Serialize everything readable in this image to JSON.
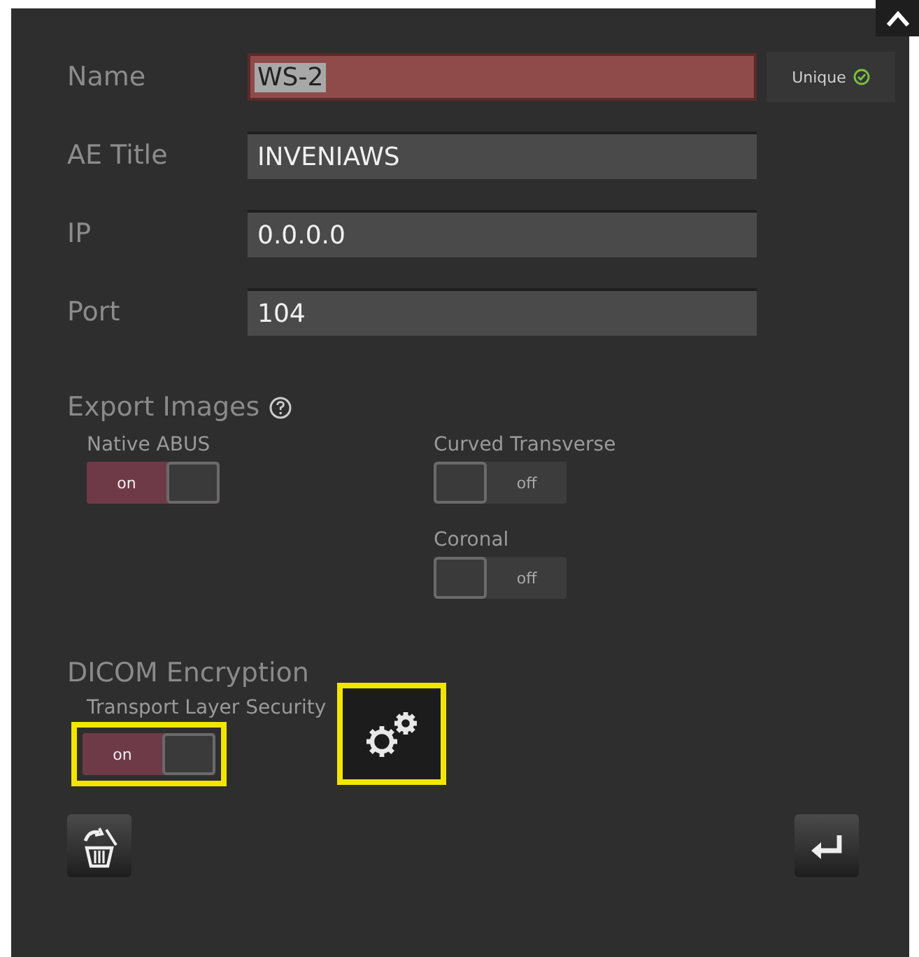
{
  "fields": [
    {
      "label": "Name",
      "value": "WS-2",
      "focused": true,
      "badge": "Unique"
    },
    {
      "label": "AE Title",
      "value": "INVENIAWS",
      "focused": false
    },
    {
      "label": "IP",
      "value": "0.0.0.0",
      "focused": false
    },
    {
      "label": "Port",
      "value": "104",
      "focused": false
    }
  ],
  "export_images": {
    "title": "Export Images",
    "columns": [
      [
        {
          "label": "Native ABUS",
          "on": true,
          "state_text": "on"
        }
      ],
      [
        {
          "label": "Curved Transverse",
          "on": false,
          "state_text": "off"
        },
        {
          "label": "Coronal",
          "on": false,
          "state_text": "off"
        }
      ]
    ]
  },
  "encryption": {
    "title": "DICOM Encryption",
    "toggle": {
      "label": "Transport Layer Security",
      "on": true,
      "state_text": "on",
      "highlighted": true
    },
    "settings_highlighted": true
  }
}
